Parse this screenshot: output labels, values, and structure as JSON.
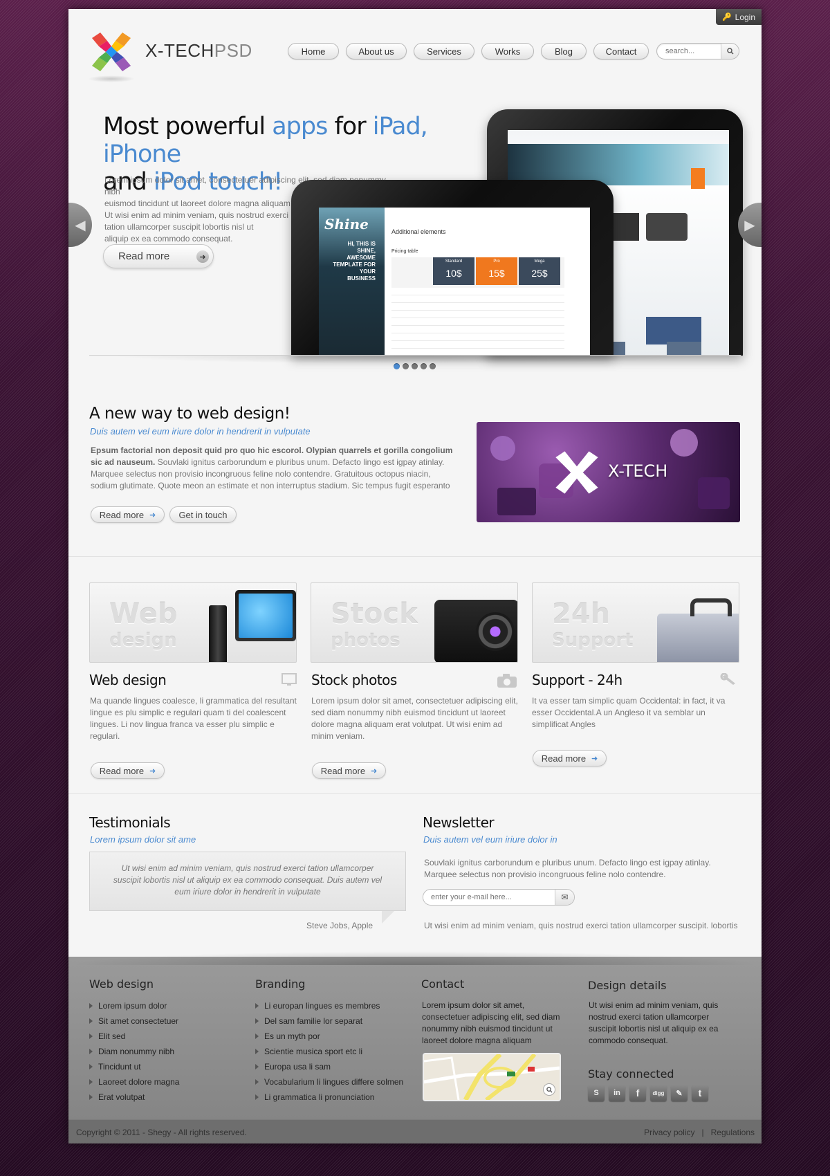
{
  "header": {
    "login_label": "Login",
    "logo_bold": "X-TECH",
    "logo_light": "PSD",
    "nav": [
      "Home",
      "About us",
      "Services",
      "Works",
      "Blog",
      "Contact"
    ],
    "search_placeholder": "search..."
  },
  "hero": {
    "title_1": "Most powerful ",
    "title_2": "apps",
    "title_3": " for ",
    "title_4": "iPad, iPhone",
    "title_5": "and ",
    "title_6": "iPod touch!",
    "text_lines": [
      "Lorem ipsum dolor sit amet, consectetuer adipiscing elit, sed diam nonummy nibh",
      "euismod tincidunt ut laoreet dolore magna aliquam erat volutpat.",
      "Ut wisi enim ad minim veniam, quis nostrud exerci",
      "tation ullamcorper suscipit lobortis nisl ut",
      "aliquip ex ea commodo consequat."
    ],
    "read_more": "Read more",
    "slides": 5,
    "active_slide": 1,
    "tablet_screen": {
      "brand": "Shine",
      "tagline_lines": [
        "HI, THIS IS",
        "SHINE,",
        "AWESOME",
        "TEMPLATE FOR",
        "YOUR",
        "BUSINESS"
      ],
      "section": "Additional elements",
      "table_title": "Pricing table",
      "prices": [
        "10$",
        "15$",
        "25$"
      ],
      "plans": [
        "Standard",
        "Pro",
        "Mega"
      ]
    }
  },
  "intro": {
    "title": "A new way to web design!",
    "subtitle": "Duis autem vel eum iriure dolor in hendrerit in vulputate",
    "bold_text": "Epsum factorial non deposit quid pro quo hic escorol. Olypian quarrels et gorilla congolium sic ad nauseum.",
    "text": " Souvlaki ignitus carborundum e pluribus unum. Defacto lingo est igpay atinlay. Marquee selectus non provisio incongruous feline nolo contendre. Gratuitous octopus niacin, sodium glutimate. Quote meon an estimate et non interruptus stadium. Sic tempus fugit esperanto",
    "read_more": "Read more",
    "get_in_touch": "Get in touch",
    "banner_text": "X-TECH"
  },
  "services": [
    {
      "img_big": "Web",
      "img_small": "design",
      "title": "Web design",
      "icon": "monitor-icon",
      "text": "Ma quande lingues coalesce, li grammatica del resultant lingue es plu simplic e regulari quam ti del coalescent lingues. Li nov lingua franca va esser plu simplic e regulari.",
      "read_more": "Read more"
    },
    {
      "img_big": "Stock",
      "img_small": "photos",
      "title": "Stock photos",
      "icon": "camera-icon",
      "text": "Lorem ipsum dolor sit amet, consectetuer adipiscing elit, sed diam nonummy nibh euismod tincidunt ut laoreet dolore magna aliquam erat volutpat. Ut wisi enim ad minim veniam.",
      "read_more": "Read more"
    },
    {
      "img_big": "24h",
      "img_small": "Support",
      "title": "Support - 24h",
      "icon": "wrench-icon",
      "text": "It va esser tam simplic quam Occidental: in fact, it va esser Occidental.A un Angleso it va semblar un simplificat Angles",
      "read_more": "Read more"
    }
  ],
  "testimonials": {
    "title": "Testimonials",
    "subtitle": "Lorem ipsum dolor sit ame",
    "quote": "Ut wisi enim ad minim veniam, quis nostrud exerci tation ullamcorper suscipit lobortis nisl ut aliquip ex ea commodo consequat. Duis autem vel eum iriure dolor in hendrerit in vulputate",
    "author": "Steve Jobs, Apple"
  },
  "newsletter": {
    "title": "Newsletter",
    "subtitle": "Duis autem vel eum iriure dolor in",
    "text": "Souvlaki ignitus carborundum e pluribus unum. Defacto lingo est igpay atinlay. Marquee selectus non provisio incongruous feline nolo contendre.",
    "email_placeholder": "enter your e-mail here...",
    "note": "Ut wisi enim ad minim veniam, quis nostrud exerci tation ullamcorper suscipit. lobortis"
  },
  "footer": {
    "col1_title": "Web design",
    "col1_items": [
      "Lorem ipsum dolor",
      "Sit amet consectetuer",
      "Elit sed",
      "Diam nonummy nibh",
      "Tincidunt ut",
      "Laoreet dolore magna",
      "Erat volutpat"
    ],
    "col2_title": "Branding",
    "col2_items": [
      "Li europan lingues es membres",
      "Del sam familie lor separat",
      "Es un myth por",
      "Scientie musica sport etc li",
      "Europa usa li sam",
      "Vocabularium li lingues differe solmen",
      "Li grammatica li pronunciation"
    ],
    "contact_title": "Contact",
    "contact_text": "Lorem ipsum dolor sit amet, consectetuer adipiscing elit, sed diam nonummy nibh euismod tincidunt ut laoreet dolore magna aliquam",
    "design_title": "Design details",
    "design_text": "Ut wisi enim ad minim veniam, quis nostrud exerci tation ullamcorper suscipit lobortis nisl ut aliquip ex ea commodo consequat.",
    "stay_title": "Stay connected",
    "social": [
      {
        "name": "skype-icon",
        "glyph": "S"
      },
      {
        "name": "linkedin-icon",
        "glyph": "in"
      },
      {
        "name": "facebook-icon",
        "glyph": "f"
      },
      {
        "name": "digg-icon",
        "glyph": "digg"
      },
      {
        "name": "delicious-icon",
        "glyph": "✎"
      },
      {
        "name": "twitter-icon",
        "glyph": "t"
      }
    ],
    "copyright": "Copyright © 2011 - Shegy - All rights reserved.",
    "privacy": "Privacy policy",
    "separator": "|",
    "regulations": "Regulations"
  },
  "colors": {
    "accent": "#4a8ad0",
    "footer": "#8f8f8f",
    "bg": "#3a1233"
  }
}
